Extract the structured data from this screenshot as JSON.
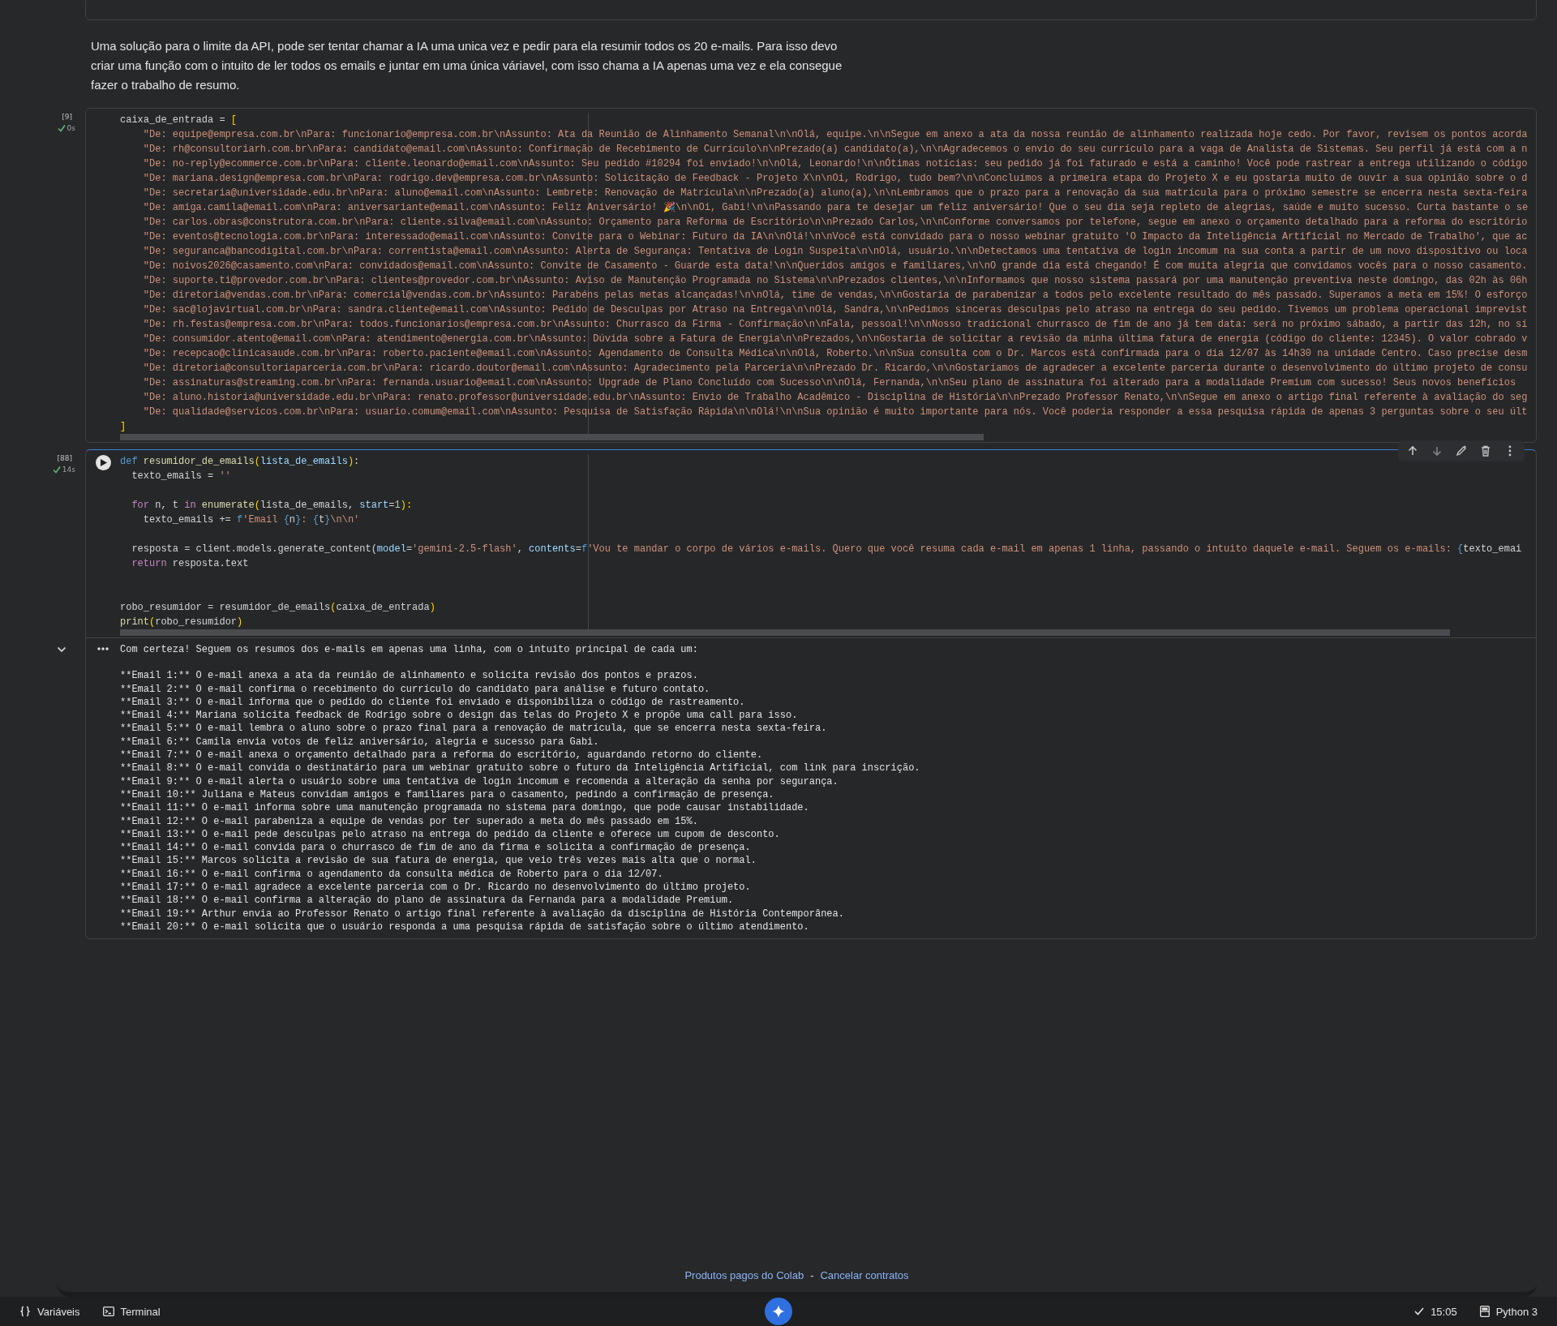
{
  "markdown": "Uma solução para o limite da API, pode ser tentar chamar a IA uma unica vez e pedir para ela resumir todos os 20 e-mails. Para isso devo criar uma função com o intuito de ler todos os emails e juntar em uma única váriavel, com isso chama a IA apenas uma vez e ela consegue fazer o trabalho de resumo.",
  "cells": [
    {
      "exec_count": "[9]",
      "duration": "0s",
      "succeeded": true,
      "focused": false,
      "lines": [
        {
          "kind": "code",
          "tokens": [
            {
              "text": "caixa_de_entrada = ",
              "kind": "plain"
            },
            {
              "text": "[",
              "kind": "paren"
            }
          ]
        },
        {
          "kind": "code",
          "tokens": [
            {
              "text": "    \"De: equipe@empresa.com.br\\nPara: funcionario@empresa.com.br\\nAssunto: Ata da Reunião de Alinhamento Semanal\\n\\nOlá, equipe.\\n\\nSegue em anexo a ata da nossa reunião de alinhamento realizada hoje cedo. Por favor, revisem os pontos acorda",
              "kind": "string"
            }
          ]
        },
        {
          "kind": "code",
          "tokens": [
            {
              "text": "    \"De: rh@consultoriarh.com.br\\nPara: candidato@email.com\\nAssunto: Confirmação de Recebimento de Currículo\\n\\nPrezado(a) candidato(a),\\n\\nAgradecemos o envio do seu currículo para a vaga de Analista de Sistemas. Seu perfil já está com a n",
              "kind": "string"
            }
          ]
        },
        {
          "kind": "code",
          "tokens": [
            {
              "text": "    \"De: no-reply@ecommerce.com.br\\nPara: cliente.leonardo@email.com\\nAssunto: Seu pedido #10294 foi enviado!\\n\\nOlá, Leonardo!\\n\\nÓtimas notícias: seu pedido já foi faturado e está a caminho! Você pode rastrear a entrega utilizando o código",
              "kind": "string"
            }
          ]
        },
        {
          "kind": "code",
          "tokens": [
            {
              "text": "    \"De: mariana.design@empresa.com.br\\nPara: rodrigo.dev@empresa.com.br\\nAssunto: Solicitação de Feedback - Projeto X\\n\\nOi, Rodrigo, tudo bem?\\n\\nConcluímos a primeira etapa do Projeto X e eu gostaria muito de ouvir a sua opinião sobre o d",
              "kind": "string"
            }
          ]
        },
        {
          "kind": "code",
          "tokens": [
            {
              "text": "    \"De: secretaria@universidade.edu.br\\nPara: aluno@email.com\\nAssunto: Lembrete: Renovação de Matrícula\\n\\nPrezado(a) aluno(a),\\n\\nLembramos que o prazo para a renovação da sua matrícula para o próximo semestre se encerra nesta sexta-feira",
              "kind": "string"
            }
          ]
        },
        {
          "kind": "code",
          "tokens": [
            {
              "text": "    \"De: amiga.camila@email.com\\nPara: aniversariante@email.com\\nAssunto: Feliz Aniversário! 🎉\\n\\nOi, Gabi!\\n\\nPassando para te desejar um feliz aniversário! Que o seu dia seja repleto de alegrias, saúde e muito sucesso. Curta bastante o se",
              "kind": "string"
            }
          ]
        },
        {
          "kind": "code",
          "tokens": [
            {
              "text": "    \"De: carlos.obras@construtora.com.br\\nPara: cliente.silva@email.com\\nAssunto: Orçamento para Reforma de Escritório\\n\\nPrezado Carlos,\\n\\nConforme conversamos por telefone, segue em anexo o orçamento detalhado para a reforma do escritório",
              "kind": "string"
            }
          ]
        },
        {
          "kind": "code",
          "tokens": [
            {
              "text": "    \"De: eventos@tecnologia.com.br\\nPara: interessado@email.com\\nAssunto: Convite para o Webinar: Futuro da IA\\n\\nOlá!\\n\\nVocê está convidado para o nosso webinar gratuito 'O Impacto da Inteligência Artificial no Mercado de Trabalho', que ac",
              "kind": "string"
            }
          ]
        },
        {
          "kind": "code",
          "tokens": [
            {
              "text": "    \"De: seguranca@bancodigital.com.br\\nPara: correntista@email.com\\nAssunto: Alerta de Segurança: Tentativa de Login Suspeita\\n\\nOlá, usuário.\\n\\nDetectamos uma tentativa de login incomum na sua conta a partir de um novo dispositivo ou loca",
              "kind": "string"
            }
          ]
        },
        {
          "kind": "code",
          "tokens": [
            {
              "text": "    \"De: noivos2026@casamento.com\\nPara: convidados@email.com\\nAssunto: Convite de Casamento - Guarde esta data!\\n\\nQueridos amigos e familiares,\\n\\nO grande dia está chegando! É com muita alegria que convidamos vocês para o nosso casamento.",
              "kind": "string"
            }
          ]
        },
        {
          "kind": "code",
          "tokens": [
            {
              "text": "    \"De: suporte.ti@provedor.com.br\\nPara: clientes@provedor.com.br\\nAssunto: Aviso de Manutenção Programada no Sistema\\n\\nPrezados clientes,\\n\\nInformamos que nosso sistema passará por uma manutenção preventiva neste domingo, das 02h às 06h",
              "kind": "string"
            }
          ]
        },
        {
          "kind": "code",
          "tokens": [
            {
              "text": "    \"De: diretoria@vendas.com.br\\nPara: comercial@vendas.com.br\\nAssunto: Parabéns pelas metas alcançadas!\\n\\nOlá, time de vendas,\\n\\nGostaria de parabenizar a todos pelo excelente resultado do mês passado. Superamos a meta em 15%! O esforço",
              "kind": "string"
            }
          ]
        },
        {
          "kind": "code",
          "tokens": [
            {
              "text": "    \"De: sac@lojavirtual.com.br\\nPara: sandra.cliente@email.com\\nAssunto: Pedido de Desculpas por Atraso na Entrega\\n\\nOlá, Sandra,\\n\\nPedimos sinceras desculpas pelo atraso na entrega do seu pedido. Tivemos um problema operacional imprevist",
              "kind": "string"
            }
          ]
        },
        {
          "kind": "code",
          "tokens": [
            {
              "text": "    \"De: rh.festas@empresa.com.br\\nPara: todos.funcionarios@empresa.com.br\\nAssunto: Churrasco da Firma - Confirmação\\n\\nFala, pessoal!\\n\\nNosso tradicional churrasco de fim de ano já tem data: será no próximo sábado, a partir das 12h, no sí",
              "kind": "string"
            }
          ]
        },
        {
          "kind": "code",
          "tokens": [
            {
              "text": "    \"De: consumidor.atento@email.com\\nPara: atendimento@energia.com.br\\nAssunto: Dúvida sobre a Fatura de Energia\\n\\nPrezados,\\n\\nGostaria de solicitar a revisão da minha última fatura de energia (código do cliente: 12345). O valor cobrado v",
              "kind": "string"
            }
          ]
        },
        {
          "kind": "code",
          "tokens": [
            {
              "text": "    \"De: recepcao@clinicasaude.com.br\\nPara: roberto.paciente@email.com\\nAssunto: Agendamento de Consulta Médica\\n\\nOlá, Roberto.\\n\\nSua consulta com o Dr. Marcos está confirmada para o dia 12/07 às 14h30 na unidade Centro. Caso precise desm",
              "kind": "string"
            }
          ]
        },
        {
          "kind": "code",
          "tokens": [
            {
              "text": "    \"De: diretoria@consultoriaparceria.com.br\\nPara: ricardo.doutor@email.com\\nAssunto: Agradecimento pela Parceria\\n\\nPrezado Dr. Ricardo,\\n\\nGostaríamos de agradecer a excelente parceria durante o desenvolvimento do último projeto de consu",
              "kind": "string"
            }
          ]
        },
        {
          "kind": "code",
          "tokens": [
            {
              "text": "    \"De: assinaturas@streaming.com.br\\nPara: fernanda.usuario@email.com\\nAssunto: Upgrade de Plano Concluído com Sucesso\\n\\nOlá, Fernanda,\\n\\nSeu plano de assinatura foi alterado para a modalidade Premium com sucesso! Seus novos benefícios",
              "kind": "string"
            }
          ]
        },
        {
          "kind": "code",
          "tokens": [
            {
              "text": "    \"De: aluno.historia@universidade.edu.br\\nPara: renato.professor@universidade.edu.br\\nAssunto: Envio de Trabalho Acadêmico - Disciplina de História\\n\\nPrezado Professor Renato,\\n\\nSegue em anexo o artigo final referente à avaliação do seg",
              "kind": "string"
            }
          ]
        },
        {
          "kind": "code",
          "tokens": [
            {
              "text": "    \"De: qualidade@servicos.com.br\\nPara: usuario.comum@email.com\\nAssunto: Pesquisa de Satisfação Rápida\\n\\nOlá!\\n\\nSua opinião é muito importante para nós. Você poderia responder a essa pesquisa rápida de apenas 3 perguntas sobre o seu últ",
              "kind": "string"
            }
          ]
        },
        {
          "kind": "code",
          "tokens": [
            {
              "text": "]",
              "kind": "paren"
            }
          ]
        }
      ]
    },
    {
      "exec_count": "[88]",
      "duration": "14s",
      "succeeded": true,
      "focused": true,
      "lines": [
        {
          "kind": "code",
          "tokens": [
            {
              "text": "def ",
              "kind": "keyword"
            },
            {
              "text": "resumidor_de_emails",
              "kind": "function"
            },
            {
              "text": "(",
              "kind": "paren"
            },
            {
              "text": "lista_de_emails",
              "kind": "param"
            },
            {
              "text": ")",
              "kind": "paren"
            },
            {
              "text": ":",
              "kind": "plain"
            }
          ]
        },
        {
          "kind": "code",
          "tokens": [
            {
              "text": "  texto_emails = ",
              "kind": "plain"
            },
            {
              "text": "''",
              "kind": "string"
            }
          ]
        },
        {
          "kind": "blank"
        },
        {
          "kind": "code",
          "tokens": [
            {
              "text": "  for ",
              "kind": "control"
            },
            {
              "text": "n, t ",
              "kind": "plain"
            },
            {
              "text": "in ",
              "kind": "control"
            },
            {
              "text": "enumerate",
              "kind": "function"
            },
            {
              "text": "(",
              "kind": "paren"
            },
            {
              "text": "lista_de_emails, ",
              "kind": "plain"
            },
            {
              "text": "start",
              "kind": "param"
            },
            {
              "text": "=",
              "kind": "plain"
            },
            {
              "text": "1",
              "kind": "number"
            },
            {
              "text": "):",
              "kind": "paren"
            }
          ]
        },
        {
          "kind": "code",
          "tokens": [
            {
              "text": "    texto_emails += ",
              "kind": "plain"
            },
            {
              "text": "f",
              "kind": "keyword"
            },
            {
              "text": "'Email ",
              "kind": "string"
            },
            {
              "text": "{",
              "kind": "keyword"
            },
            {
              "text": "n",
              "kind": "plain"
            },
            {
              "text": "}",
              "kind": "keyword"
            },
            {
              "text": ": ",
              "kind": "string"
            },
            {
              "text": "{",
              "kind": "keyword"
            },
            {
              "text": "t",
              "kind": "plain"
            },
            {
              "text": "}",
              "kind": "keyword"
            },
            {
              "text": "\\n\\n'",
              "kind": "string"
            }
          ]
        },
        {
          "kind": "blank"
        },
        {
          "kind": "code",
          "tokens": [
            {
              "text": "  resposta = client.models.generate_content(",
              "kind": "plain"
            },
            {
              "text": "model",
              "kind": "param"
            },
            {
              "text": "=",
              "kind": "plain"
            },
            {
              "text": "'gemini-2.5-flash'",
              "kind": "string"
            },
            {
              "text": ", ",
              "kind": "plain"
            },
            {
              "text": "contents",
              "kind": "param"
            },
            {
              "text": "=",
              "kind": "plain"
            },
            {
              "text": "f",
              "kind": "keyword"
            },
            {
              "text": "'Vou te mandar o corpo de vários e-mails. Quero que você resuma cada e-mail em apenas 1 linha, passando o intuito daquele e-mail. Seguem os e-mails: ",
              "kind": "string"
            },
            {
              "text": "{",
              "kind": "keyword"
            },
            {
              "text": "texto_emai",
              "kind": "plain"
            }
          ]
        },
        {
          "kind": "code",
          "tokens": [
            {
              "text": "  return ",
              "kind": "control"
            },
            {
              "text": "resposta.text",
              "kind": "plain"
            }
          ]
        },
        {
          "kind": "blank"
        },
        {
          "kind": "blank"
        },
        {
          "kind": "code",
          "tokens": [
            {
              "text": "robo_resumidor = resumidor_de_emails",
              "kind": "plain"
            },
            {
              "text": "(",
              "kind": "paren"
            },
            {
              "text": "caixa_de_entrada",
              "kind": "plain"
            },
            {
              "text": ")",
              "kind": "paren"
            }
          ]
        },
        {
          "kind": "code",
          "tokens": [
            {
              "text": "print",
              "kind": "function"
            },
            {
              "text": "(",
              "kind": "paren"
            },
            {
              "text": "robo_resumidor",
              "kind": "plain"
            },
            {
              "text": ")",
              "kind": "paren"
            }
          ]
        }
      ],
      "output": {
        "expanded": true,
        "intro": "Com certeza! Seguem os resumos dos e-mails em apenas uma linha, com o intuito principal de cada um:",
        "lines": [
          "**Email 1:** O e-mail anexa a ata da reunião de alinhamento e solicita revisão dos pontos e prazos.",
          "**Email 2:** O e-mail confirma o recebimento do currículo do candidato para análise e futuro contato.",
          "**Email 3:** O e-mail informa que o pedido do cliente foi enviado e disponibiliza o código de rastreamento.",
          "**Email 4:** Mariana solicita feedback de Rodrigo sobre o design das telas do Projeto X e propõe uma call para isso.",
          "**Email 5:** O e-mail lembra o aluno sobre o prazo final para a renovação de matrícula, que se encerra nesta sexta-feira.",
          "**Email 6:** Camila envia votos de feliz aniversário, alegria e sucesso para Gabi.",
          "**Email 7:** O e-mail anexa o orçamento detalhado para a reforma do escritório, aguardando retorno do cliente.",
          "**Email 8:** O e-mail convida o destinatário para um webinar gratuito sobre o futuro da Inteligência Artificial, com link para inscrição.",
          "**Email 9:** O e-mail alerta o usuário sobre uma tentativa de login incomum e recomenda a alteração da senha por segurança.",
          "**Email 10:** Juliana e Mateus convidam amigos e familiares para o casamento, pedindo a confirmação de presença.",
          "**Email 11:** O e-mail informa sobre uma manutenção programada no sistema para domingo, que pode causar instabilidade.",
          "**Email 12:** O e-mail parabeniza a equipe de vendas por ter superado a meta do mês passado em 15%.",
          "**Email 13:** O e-mail pede desculpas pelo atraso na entrega do pedido da cliente e oferece um cupom de desconto.",
          "**Email 14:** O e-mail convida para o churrasco de fim de ano da firma e solicita a confirmação de presença.",
          "**Email 15:** Marcos solicita a revisão de sua fatura de energia, que veio três vezes mais alta que o normal.",
          "**Email 16:** O e-mail confirma o agendamento da consulta médica de Roberto para o dia 12/07.",
          "**Email 17:** O e-mail agradece a excelente parceria com o Dr. Ricardo no desenvolvimento do último projeto.",
          "**Email 18:** O e-mail confirma a alteração do plano de assinatura da Fernanda para a modalidade Premium.",
          "**Email 19:** Arthur envia ao Professor Renato o artigo final referente à avaliação da disciplina de História Contemporânea.",
          "**Email 20:** O e-mail solicita que o usuário responda a uma pesquisa rápida de satisfação sobre o último atendimento."
        ]
      }
    }
  ],
  "footer": {
    "links": [
      "Produtos pagos do Colab",
      "Cancelar contratos"
    ],
    "separator": "-"
  },
  "status_bar": {
    "variables": "Variáveis",
    "terminal": "Terminal",
    "time": "15:05",
    "runtime": "Python 3"
  }
}
